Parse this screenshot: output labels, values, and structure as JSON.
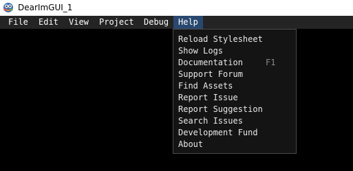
{
  "window": {
    "title": "DearImGUI_1",
    "icon": "dear-imgui-app-icon"
  },
  "menubar": {
    "items": [
      {
        "label": "File"
      },
      {
        "label": "Edit"
      },
      {
        "label": "View"
      },
      {
        "label": "Project"
      },
      {
        "label": "Debug"
      },
      {
        "label": "Help",
        "active": true
      }
    ],
    "active_color": "#29486f",
    "background": "#242424"
  },
  "help_menu": {
    "items": [
      {
        "label": "Reload Stylesheet",
        "shortcut": ""
      },
      {
        "label": "Show Logs",
        "shortcut": ""
      },
      {
        "label": "Documentation",
        "shortcut": "F1"
      },
      {
        "label": "Support Forum",
        "shortcut": ""
      },
      {
        "label": "Find Assets",
        "shortcut": ""
      },
      {
        "label": "Report Issue",
        "shortcut": ""
      },
      {
        "label": "Report Suggestion",
        "shortcut": ""
      },
      {
        "label": "Search Issues",
        "shortcut": ""
      },
      {
        "label": "Development Fund",
        "shortcut": ""
      },
      {
        "label": "About",
        "shortcut": ""
      }
    ]
  }
}
